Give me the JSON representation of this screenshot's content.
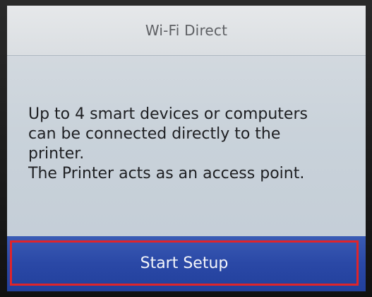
{
  "header": {
    "title": "Wi-Fi Direct"
  },
  "message": {
    "lines": [
      "Up to 4 smart devices or computers",
      "can be connected directly to the",
      "printer.",
      "The Printer acts as an access point."
    ]
  },
  "action": {
    "start_label": "Start Setup"
  },
  "colors": {
    "action_bar": "#2a48a6",
    "highlight": "#e0242a"
  }
}
